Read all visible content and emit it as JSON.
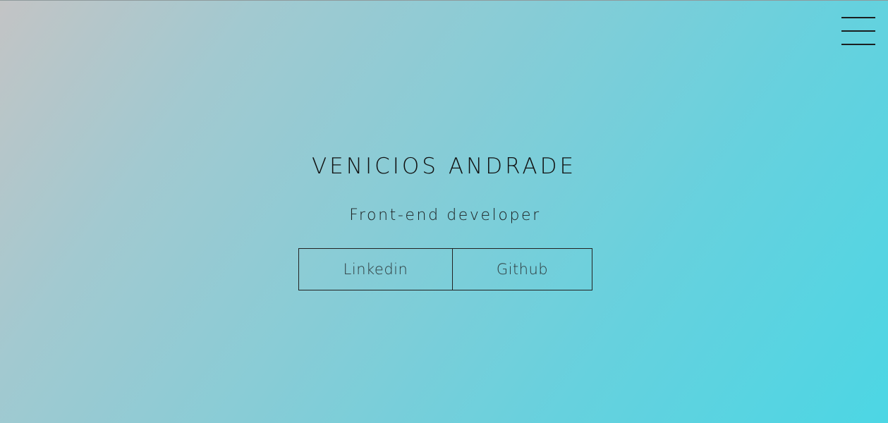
{
  "header": {
    "menu_icon": "hamburger-menu-icon"
  },
  "hero": {
    "name": "VENICIOS ANDRADE",
    "role": "Front-end developer",
    "links": [
      {
        "label": "Linkedin"
      },
      {
        "label": "Github"
      }
    ]
  },
  "colors": {
    "gradient_start": "#c3c4c5",
    "gradient_end": "#4cd6e4",
    "text": "#111111",
    "border": "#222222"
  }
}
